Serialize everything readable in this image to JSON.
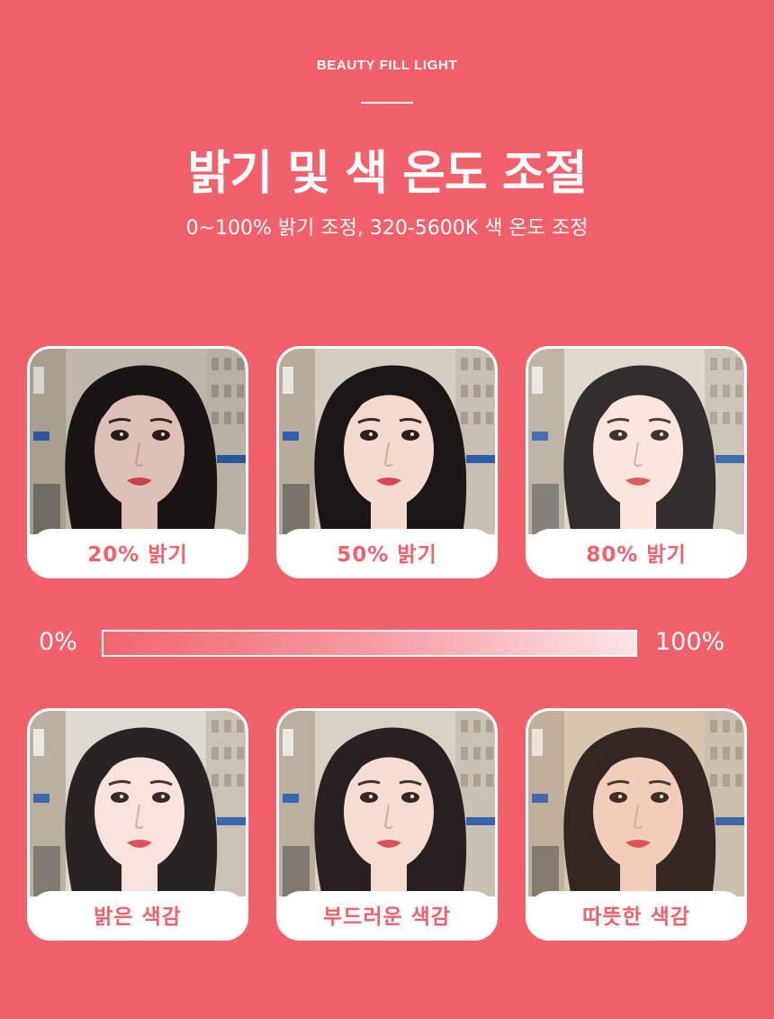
{
  "header": {
    "eyebrow": "BEAUTY FILL LIGHT",
    "title": "밝기 및 색 온도 조절",
    "subtitle": "0~100% 밝기 조정, 320-5600K 색 온도 조정"
  },
  "brightness_samples": [
    {
      "label": "20% 밝기",
      "brightness": 0.2
    },
    {
      "label": "50% 밝기",
      "brightness": 0.5
    },
    {
      "label": "80% 밝기",
      "brightness": 0.8
    }
  ],
  "brightness_scale": {
    "min_label": "0%",
    "max_label": "100%"
  },
  "tone_samples": [
    {
      "label": "밝은 색감"
    },
    {
      "label": "부드러운 색감"
    },
    {
      "label": "따뜻한 색감"
    }
  ],
  "colors": {
    "background": "#f2616b",
    "accent_text": "#f2616b",
    "card": "#ffffff"
  }
}
